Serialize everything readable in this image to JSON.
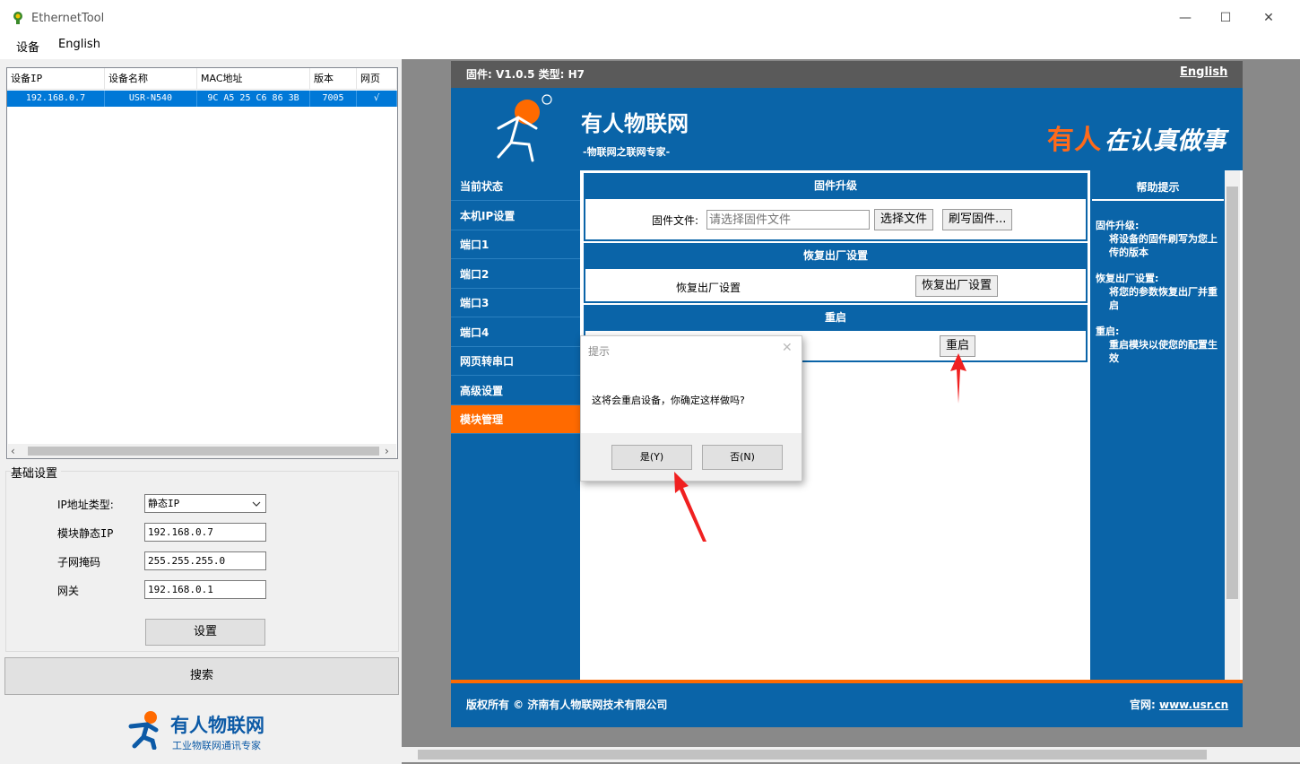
{
  "window": {
    "title": "EthernetTool",
    "minimize": "—",
    "maximize": "☐",
    "close": "✕"
  },
  "menu": {
    "device": "设备",
    "english": "English"
  },
  "device_table": {
    "headers": [
      "设备IP",
      "设备名称",
      "MAC地址",
      "版本",
      "网页"
    ],
    "rows": [
      {
        "ip": "192.168.0.7",
        "name": "USR-N540",
        "mac": "9C A5 25 C6 86 3B",
        "version": "7005",
        "web": "√"
      }
    ],
    "scroll_left": "‹",
    "scroll_right": "›"
  },
  "basic_settings": {
    "title": "基础设置",
    "ip_type_label": "IP地址类型:",
    "ip_type_value": "静态IP",
    "static_ip_label": "模块静态IP",
    "static_ip_value": "192.168.0.7",
    "subnet_label": "子网掩码",
    "subnet_value": "255.255.255.0",
    "gateway_label": "网关",
    "gateway_value": "192.168.0.1",
    "set_button": "设置",
    "search_button": "搜索"
  },
  "bottom_brand": {
    "name": "有人物联网",
    "sub": "工业物联网通讯专家"
  },
  "web": {
    "firmware_label": "固件: V1.0.5 类型: H7",
    "english_link": "English",
    "brand_name": "有人物联网",
    "brand_tagline": "-物联网之联网专家-",
    "slogan_a": "有人",
    "slogan_b": "在认真做事",
    "nav": [
      "当前状态",
      "本机IP设置",
      "端口1",
      "端口2",
      "端口3",
      "端口4",
      "网页转串口",
      "高级设置",
      "模块管理"
    ],
    "firmware_upgrade": {
      "title": "固件升级",
      "file_label": "固件文件:",
      "file_placeholder": "请选择固件文件",
      "choose_button": "选择文件",
      "flash_button": "刷写固件..."
    },
    "factory_reset": {
      "title": "恢复出厂设置",
      "label": "恢复出厂设置",
      "button": "恢复出厂设置"
    },
    "reboot": {
      "title": "重启",
      "button": "重启"
    },
    "help": {
      "title": "帮助提示",
      "items": [
        {
          "head": "固件升级:",
          "body": "将设备的固件刷写为您上传的版本"
        },
        {
          "head": "恢复出厂设置:",
          "body": "将您的参数恢复出厂并重启"
        },
        {
          "head": "重启:",
          "body": "重启模块以使您的配置生效"
        }
      ]
    },
    "footer": {
      "copyright": "版权所有 © 济南有人物联网技术有限公司",
      "site_label": "官网:",
      "site_url": "www.usr.cn"
    }
  },
  "dialog": {
    "title": "提示",
    "message": "这将会重启设备，你确定这样做吗?",
    "yes": "是(Y)",
    "no": "否(N)",
    "close": "✕"
  },
  "colors": {
    "accent_blue": "#0a64a8",
    "accent_orange": "#ff6a00",
    "selection": "#0078d7",
    "arrow_red": "#f02020"
  }
}
